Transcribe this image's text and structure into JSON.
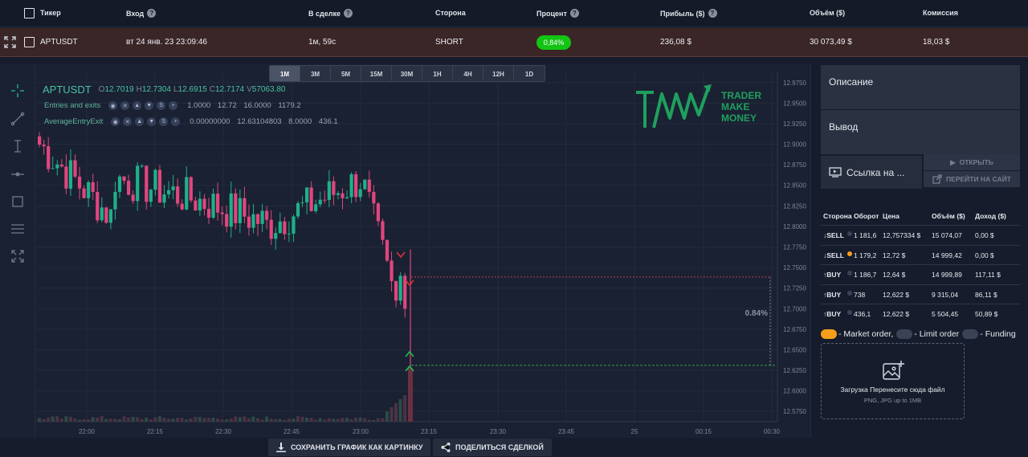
{
  "table": {
    "headers": {
      "ticker": "Тикер",
      "entry": "Вход",
      "in_trade": "В сделке",
      "side": "Сторона",
      "percent": "Процент",
      "profit": "Прибыль ($)",
      "volume": "Объём ($)",
      "commission": "Комиссия"
    },
    "row": {
      "ticker": "APTUSDT",
      "entry": "вт 24 янв. 23 23:09:46",
      "in_trade": "1м, 59с",
      "side": "SHORT",
      "percent": "0,84%",
      "profit": "236,08 $",
      "volume": "30 073,49 $",
      "commission": "18,03 $"
    }
  },
  "timeframes": [
    "1M",
    "3M",
    "5M",
    "15M",
    "30M",
    "1H",
    "4H",
    "12H",
    "1D"
  ],
  "active_timeframe": "1M",
  "chart": {
    "symbol": "APTUSDT",
    "ohlc": [
      {
        "k": "O",
        "v": "12.7019"
      },
      {
        "k": "H",
        "v": "12.7304"
      },
      {
        "k": "L",
        "v": "12.6915"
      },
      {
        "k": "C",
        "v": "12.7174"
      },
      {
        "k": "V",
        "v": "57063.80"
      }
    ],
    "indicators": [
      {
        "name": "Entries and exits",
        "values": "1.0000  12.72  16.0000  1179.2"
      },
      {
        "name": "AverageEntryExit",
        "values": "0.00000000  12.63104803  8.0000  436.1"
      }
    ],
    "price_labels": [
      "12.9750",
      "12.9500",
      "12.9250",
      "12.9000",
      "12.8750",
      "12.8500",
      "12.8250",
      "12.8000",
      "12.7750",
      "12.7500",
      "12.7250",
      "12.7000",
      "12.6750",
      "12.6500",
      "12.6250",
      "12.6000",
      "12.5750"
    ],
    "time_labels": [
      "22:00",
      "22:15",
      "22:30",
      "22:45",
      "23:00",
      "23:15",
      "23:30",
      "23:45",
      "25",
      "00:15",
      "00:30"
    ],
    "trade_percent_label": "0.84%",
    "logo": [
      "TRADER",
      "MAKE",
      "MONEY"
    ],
    "save_button": "СОХРАНИТЬ ГРАФИК КАК КАРТИНКУ",
    "share_button": "ПОДЕЛИТЬСЯ СДЕЛКОЙ",
    "colors": {
      "up": "#1fb08a",
      "down": "#e0467e",
      "bg": "#1a2132",
      "grid": "#232b3c"
    }
  },
  "panel": {
    "description": "Описание",
    "conclusion": "Вывод",
    "link": "Ссылка на ...",
    "open": "ОТКРЫТЬ",
    "go_to_site": "ПЕРЕЙТИ НА САЙТ"
  },
  "trades": {
    "headers": [
      "Сторона",
      "Оборот",
      "Цена",
      "Объём ($)",
      "Доход ($)"
    ],
    "rows": [
      {
        "side": "SELL",
        "dir": "down",
        "turnover": "1 181,6",
        "price": "12,757334 $",
        "volume": "15 074,07",
        "income": "0,00 $",
        "order": "limit"
      },
      {
        "side": "SELL",
        "dir": "down",
        "turnover": "1 179,2",
        "price": "12,72 $",
        "volume": "14 999,42",
        "income": "0,00 $",
        "order": "market"
      },
      {
        "side": "BUY",
        "dir": "up",
        "turnover": "1 186,7",
        "price": "12,64 $",
        "volume": "14 999,89",
        "income": "117,11 $",
        "order": "limit"
      },
      {
        "side": "BUY",
        "dir": "up",
        "turnover": "738",
        "price": "12,622 $",
        "volume": "9 315,04",
        "income": "86,11 $",
        "order": "limit"
      },
      {
        "side": "BUY",
        "dir": "up",
        "turnover": "436,1",
        "price": "12,622 $",
        "volume": "5 504,45",
        "income": "50,89 $",
        "order": "limit"
      }
    ]
  },
  "order_legend": {
    "market": "- Market order,",
    "limit": "- Limit order",
    "funding": "- Funding",
    "colors": {
      "market": "#f5a01a",
      "limit": "#3a4356",
      "funding": "#3a4356"
    }
  },
  "upload": {
    "title": "Загрузка Перенесите сюда файл",
    "subtitle": "PNG, JPG up to 1MB"
  }
}
